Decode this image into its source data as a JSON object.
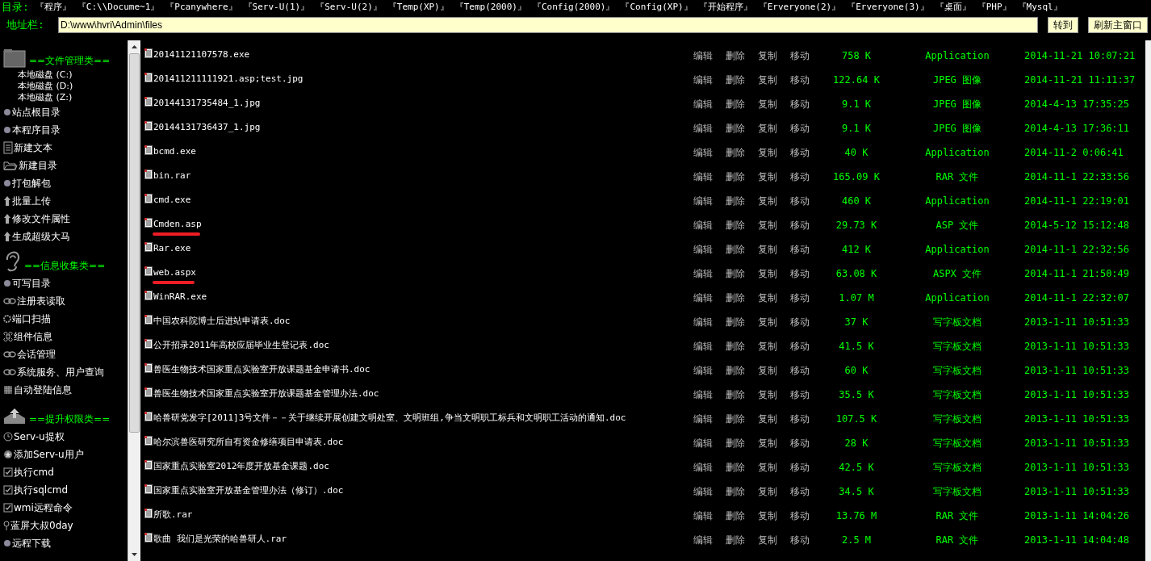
{
  "directory_bar": {
    "label": "目录:",
    "links": [
      "『程序』",
      "『C:\\\\Docume~1』",
      "『Pcanywhere』",
      "『Serv-U(1)』",
      "『Serv-U(2)』",
      "『Temp(XP)』",
      "『Temp(2000)』",
      "『Config(2000)』",
      "『Config(XP)』",
      "『开始程序』",
      "『Erveryone(2)』",
      "『Erveryone(3)』",
      "『桌面』",
      "『PHP』",
      "『Mysql』"
    ]
  },
  "address_bar": {
    "label": "地址栏:",
    "value": "D:\\www\\hvri\\Admin\\files",
    "buttons": [
      "转到",
      "刷新主窗口"
    ]
  },
  "sidebar": {
    "items": [
      {
        "kind": "section",
        "label": "==文件管理类=="
      },
      {
        "kind": "drive",
        "label": "本地磁盘 (C:)"
      },
      {
        "kind": "drive",
        "label": "本地磁盘 (D:)"
      },
      {
        "kind": "drive",
        "label": "本地磁盘 (Z:)"
      },
      {
        "kind": "link",
        "label": "站点根目录"
      },
      {
        "kind": "link",
        "label": "本程序目录"
      },
      {
        "kind": "link",
        "label": "新建文本"
      },
      {
        "kind": "link",
        "label": "新建目录"
      },
      {
        "kind": "link",
        "label": "打包解包"
      },
      {
        "kind": "link",
        "label": "批量上传"
      },
      {
        "kind": "link",
        "label": "修改文件属性"
      },
      {
        "kind": "link",
        "label": "生成超级大马"
      },
      {
        "kind": "section",
        "label": "==信息收集类=="
      },
      {
        "kind": "link",
        "label": "可写目录"
      },
      {
        "kind": "link",
        "label": "注册表读取"
      },
      {
        "kind": "link",
        "label": "端口扫描"
      },
      {
        "kind": "link",
        "label": "组件信息"
      },
      {
        "kind": "link",
        "label": "会话管理"
      },
      {
        "kind": "link",
        "label": "系统服务、用户查询"
      },
      {
        "kind": "link",
        "label": "自动登陆信息"
      },
      {
        "kind": "section",
        "label": "==提升权限类=="
      },
      {
        "kind": "link",
        "label": "Serv-u提权"
      },
      {
        "kind": "link",
        "label": "添加Serv-u用户"
      },
      {
        "kind": "link",
        "label": "执行cmd"
      },
      {
        "kind": "link",
        "label": "执行sqlcmd"
      },
      {
        "kind": "link",
        "label": "wmi远程命令"
      },
      {
        "kind": "link",
        "label": "蓝屏大叔0day"
      },
      {
        "kind": "link",
        "label": "远程下载"
      }
    ]
  },
  "file_table": {
    "rows": [
      {
        "actions": [
          "编辑",
          "删除",
          "复制",
          "移动"
        ],
        "name": "20141121107578.exe",
        "size": "758 K",
        "type": "Application",
        "modified": "2014-11-21 10:07:21",
        "underlined": false
      },
      {
        "actions": [
          "编辑",
          "删除",
          "复制",
          "移动"
        ],
        "name": "201411211111921.asp;test.jpg",
        "size": "122.64 K",
        "type": "JPEG 图像",
        "modified": "2014-11-21 11:11:37",
        "underlined": false
      },
      {
        "actions": [
          "编辑",
          "删除",
          "复制",
          "移动"
        ],
        "name": "20144131735484_1.jpg",
        "size": "9.1 K",
        "type": "JPEG 图像",
        "modified": "2014-4-13 17:35:25",
        "underlined": false
      },
      {
        "actions": [
          "编辑",
          "删除",
          "复制",
          "移动"
        ],
        "name": "20144131736437_1.jpg",
        "size": "9.1 K",
        "type": "JPEG 图像",
        "modified": "2014-4-13 17:36:11",
        "underlined": false
      },
      {
        "actions": [
          "编辑",
          "删除",
          "复制",
          "移动"
        ],
        "name": "bcmd.exe",
        "size": "40 K",
        "type": "Application",
        "modified": "2014-11-2 0:06:41",
        "underlined": false
      },
      {
        "actions": [
          "编辑",
          "删除",
          "复制",
          "移动"
        ],
        "name": "bin.rar",
        "size": "165.09 K",
        "type": "RAR 文件",
        "modified": "2014-11-1 22:33:56",
        "underlined": false
      },
      {
        "actions": [
          "编辑",
          "删除",
          "复制",
          "移动"
        ],
        "name": "cmd.exe",
        "size": "460 K",
        "type": "Application",
        "modified": "2014-11-1 22:19:01",
        "underlined": false
      },
      {
        "actions": [
          "编辑",
          "删除",
          "复制",
          "移动"
        ],
        "name": "Cmden.asp",
        "size": "29.73 K",
        "type": "ASP 文件",
        "modified": "2014-5-12 15:12:48",
        "underlined": true
      },
      {
        "actions": [
          "编辑",
          "删除",
          "复制",
          "移动"
        ],
        "name": "Rar.exe",
        "size": "412 K",
        "type": "Application",
        "modified": "2014-11-1 22:32:56",
        "underlined": false
      },
      {
        "actions": [
          "编辑",
          "删除",
          "复制",
          "移动"
        ],
        "name": "web.aspx",
        "size": "63.08 K",
        "type": "ASPX 文件",
        "modified": "2014-11-1 21:50:49",
        "underlined": true
      },
      {
        "actions": [
          "编辑",
          "删除",
          "复制",
          "移动"
        ],
        "name": "WinRAR.exe",
        "size": "1.07 M",
        "type": "Application",
        "modified": "2014-11-1 22:32:07",
        "underlined": false
      },
      {
        "actions": [
          "编辑",
          "删除",
          "复制",
          "移动"
        ],
        "name": "中国农科院博士后进站申请表.doc",
        "size": "37 K",
        "type": "写字板文档",
        "modified": "2013-1-11 10:51:33",
        "underlined": false
      },
      {
        "actions": [
          "编辑",
          "删除",
          "复制",
          "移动"
        ],
        "name": "公开招录2011年高校应届毕业生登记表.doc",
        "size": "41.5 K",
        "type": "写字板文档",
        "modified": "2013-1-11 10:51:33",
        "underlined": false
      },
      {
        "actions": [
          "编辑",
          "删除",
          "复制",
          "移动"
        ],
        "name": "兽医生物技术国家重点实验室开放课题基金申请书.doc",
        "size": "60 K",
        "type": "写字板文档",
        "modified": "2013-1-11 10:51:33",
        "underlined": false
      },
      {
        "actions": [
          "编辑",
          "删除",
          "复制",
          "移动"
        ],
        "name": "兽医生物技术国家重点实验室开放课题基金管理办法.doc",
        "size": "35.5 K",
        "type": "写字板文档",
        "modified": "2013-1-11 10:51:33",
        "underlined": false
      },
      {
        "actions": [
          "编辑",
          "删除",
          "复制",
          "移动"
        ],
        "name": "哈兽研党发字[2011]3号文件－－关于继续开展创建文明处室、文明班组,争当文明职工标兵和文明职工活动的通知.doc",
        "size": "107.5 K",
        "type": "写字板文档",
        "modified": "2013-1-11 10:51:33",
        "underlined": false
      },
      {
        "actions": [
          "编辑",
          "删除",
          "复制",
          "移动"
        ],
        "name": "哈尔滨兽医研究所自有资金修缮项目申请表.doc",
        "size": "28 K",
        "type": "写字板文档",
        "modified": "2013-1-11 10:51:33",
        "underlined": false
      },
      {
        "actions": [
          "编辑",
          "删除",
          "复制",
          "移动"
        ],
        "name": "国家重点实验室2012年度开放基金课题.doc",
        "size": "42.5 K",
        "type": "写字板文档",
        "modified": "2013-1-11 10:51:33",
        "underlined": false
      },
      {
        "actions": [
          "编辑",
          "删除",
          "复制",
          "移动"
        ],
        "name": "国家重点实验室开放基金管理办法（修订）.doc",
        "size": "34.5 K",
        "type": "写字板文档",
        "modified": "2013-1-11 10:51:33",
        "underlined": false
      },
      {
        "actions": [
          "编辑",
          "删除",
          "复制",
          "移动"
        ],
        "name": "所歌.rar",
        "size": "13.76 M",
        "type": "RAR 文件",
        "modified": "2013-1-11 14:04:26",
        "underlined": false
      },
      {
        "actions": [
          "编辑",
          "删除",
          "复制",
          "移动"
        ],
        "name": "歌曲 我们是光荣的哈兽研人.rar",
        "size": "2.5 M",
        "type": "RAR 文件",
        "modified": "2013-1-11 14:04:48",
        "underlined": false
      }
    ]
  }
}
